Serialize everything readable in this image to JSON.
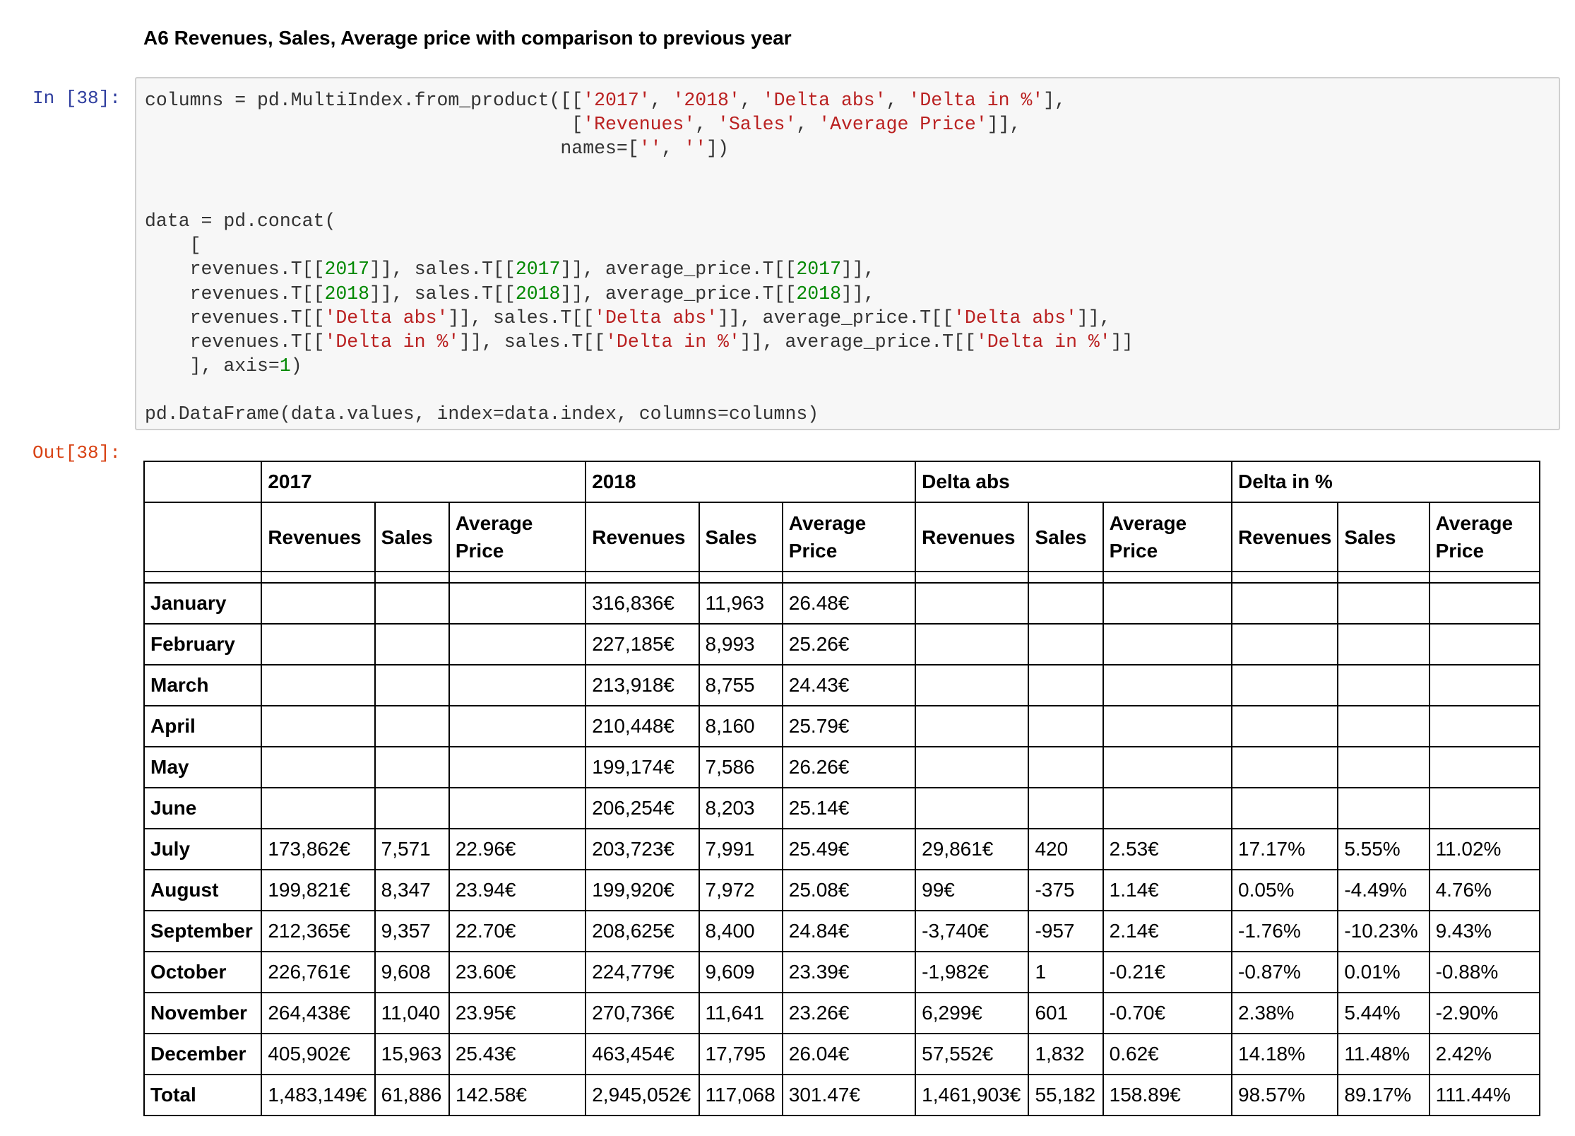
{
  "heading": "A6 Revenues, Sales, Average price with comparison to previous year",
  "prompts": {
    "input": "In [38]:",
    "output": "Out[38]:"
  },
  "code_lines": [
    "columns = pd.MultiIndex.from_product([['2017', '2018', 'Delta abs', 'Delta in %'],",
    "                                      ['Revenues', 'Sales', 'Average Price']],",
    "                                     names=['', ''])",
    "",
    "",
    "data = pd.concat(",
    "    [",
    "    revenues.T[[2017]], sales.T[[2017]], average_price.T[[2017]],",
    "    revenues.T[[2018]], sales.T[[2018]], average_price.T[[2018]],",
    "    revenues.T[['Delta abs']], sales.T[['Delta abs']], average_price.T[['Delta abs']],",
    "    revenues.T[['Delta in %']], sales.T[['Delta in %']], average_price.T[['Delta in %']]",
    "    ], axis=1)",
    "",
    "pd.DataFrame(data.values, index=data.index, columns=columns)"
  ],
  "table": {
    "groups": [
      "2017",
      "2018",
      "Delta abs",
      "Delta in %"
    ],
    "subcolumns": [
      "Revenues",
      "Sales",
      "Average Price"
    ],
    "rows": [
      {
        "label": "January",
        "cells": [
          "",
          "",
          "",
          "316,836€",
          "11,963",
          "26.48€",
          "",
          "",
          "",
          "",
          "",
          ""
        ]
      },
      {
        "label": "February",
        "cells": [
          "",
          "",
          "",
          "227,185€",
          "8,993",
          "25.26€",
          "",
          "",
          "",
          "",
          "",
          ""
        ]
      },
      {
        "label": "March",
        "cells": [
          "",
          "",
          "",
          "213,918€",
          "8,755",
          "24.43€",
          "",
          "",
          "",
          "",
          "",
          ""
        ]
      },
      {
        "label": "April",
        "cells": [
          "",
          "",
          "",
          "210,448€",
          "8,160",
          "25.79€",
          "",
          "",
          "",
          "",
          "",
          ""
        ]
      },
      {
        "label": "May",
        "cells": [
          "",
          "",
          "",
          "199,174€",
          "7,586",
          "26.26€",
          "",
          "",
          "",
          "",
          "",
          ""
        ]
      },
      {
        "label": "June",
        "cells": [
          "",
          "",
          "",
          "206,254€",
          "8,203",
          "25.14€",
          "",
          "",
          "",
          "",
          "",
          ""
        ]
      },
      {
        "label": "July",
        "cells": [
          "173,862€",
          "7,571",
          "22.96€",
          "203,723€",
          "7,991",
          "25.49€",
          "29,861€",
          "420",
          "2.53€",
          "17.17%",
          "5.55%",
          "11.02%"
        ]
      },
      {
        "label": "August",
        "cells": [
          "199,821€",
          "8,347",
          "23.94€",
          "199,920€",
          "7,972",
          "25.08€",
          "99€",
          "-375",
          "1.14€",
          "0.05%",
          "-4.49%",
          "4.76%"
        ]
      },
      {
        "label": "September",
        "cells": [
          "212,365€",
          "9,357",
          "22.70€",
          "208,625€",
          "8,400",
          "24.84€",
          "-3,740€",
          "-957",
          "2.14€",
          "-1.76%",
          "-10.23%",
          "9.43%"
        ]
      },
      {
        "label": "October",
        "cells": [
          "226,761€",
          "9,608",
          "23.60€",
          "224,779€",
          "9,609",
          "23.39€",
          "-1,982€",
          "1",
          "-0.21€",
          "-0.87%",
          "0.01%",
          "-0.88%"
        ]
      },
      {
        "label": "November",
        "cells": [
          "264,438€",
          "11,040",
          "23.95€",
          "270,736€",
          "11,641",
          "23.26€",
          "6,299€",
          "601",
          "-0.70€",
          "2.38%",
          "5.44%",
          "-2.90%"
        ]
      },
      {
        "label": "December",
        "cells": [
          "405,902€",
          "15,963",
          "25.43€",
          "463,454€",
          "17,795",
          "26.04€",
          "57,552€",
          "1,832",
          "0.62€",
          "14.18%",
          "11.48%",
          "2.42%"
        ]
      },
      {
        "label": "Total",
        "cells": [
          "1,483,149€",
          "61,886",
          "142.58€",
          "2,945,052€",
          "117,068",
          "301.47€",
          "1,461,903€",
          "55,182",
          "158.89€",
          "98.57%",
          "89.17%",
          "111.44%"
        ]
      }
    ]
  }
}
